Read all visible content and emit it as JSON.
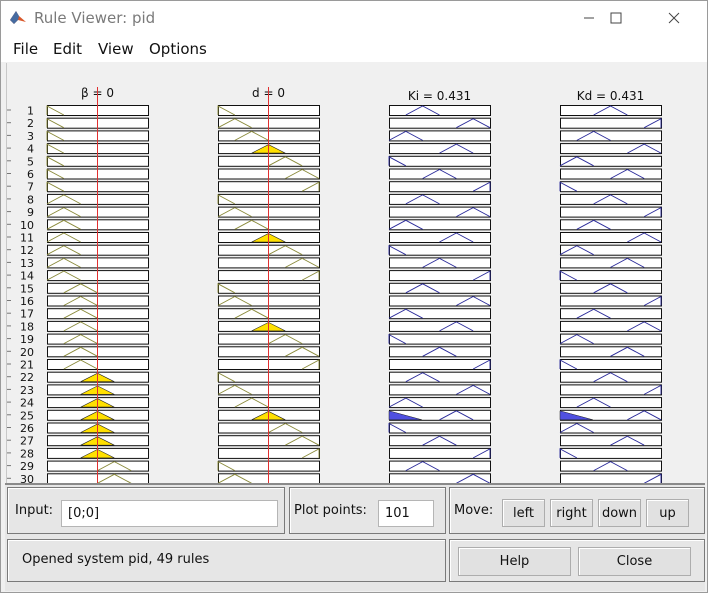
{
  "window": {
    "title": "Rule Viewer: pid"
  },
  "menu": [
    "File",
    "Edit",
    "View",
    "Options"
  ],
  "columns": [
    {
      "label": "β = 0",
      "type": "input"
    },
    {
      "label": "d = 0",
      "type": "input"
    },
    {
      "label": "Ki = 0.431",
      "type": "output"
    },
    {
      "label": "Kd = 0.431",
      "type": "output"
    }
  ],
  "row_numbers": [
    "1",
    "2",
    "3",
    "4",
    "5",
    "6",
    "7",
    "8",
    "9",
    "10",
    "11",
    "12",
    "13",
    "14",
    "15",
    "16",
    "17",
    "18",
    "19",
    "20",
    "21",
    "22",
    "23",
    "24",
    "25",
    "26",
    "27",
    "28",
    "29",
    "30"
  ],
  "input_panel": {
    "label": "Input:",
    "value": "[0;0]"
  },
  "plot_points": {
    "label": "Plot points:",
    "value": "101"
  },
  "move": {
    "label": "Move:",
    "buttons": [
      "left",
      "right",
      "down",
      "up"
    ]
  },
  "status": {
    "text": "Opened system pid, 49 rules"
  },
  "actions": {
    "help": "Help",
    "close": "Close"
  },
  "colors": {
    "input_mf": "#8a8a3a",
    "output_mf": "#2a2a9a",
    "fired_fill": "#ffe000",
    "output_fill": "#5050e0",
    "crosshair": "#e03030"
  }
}
